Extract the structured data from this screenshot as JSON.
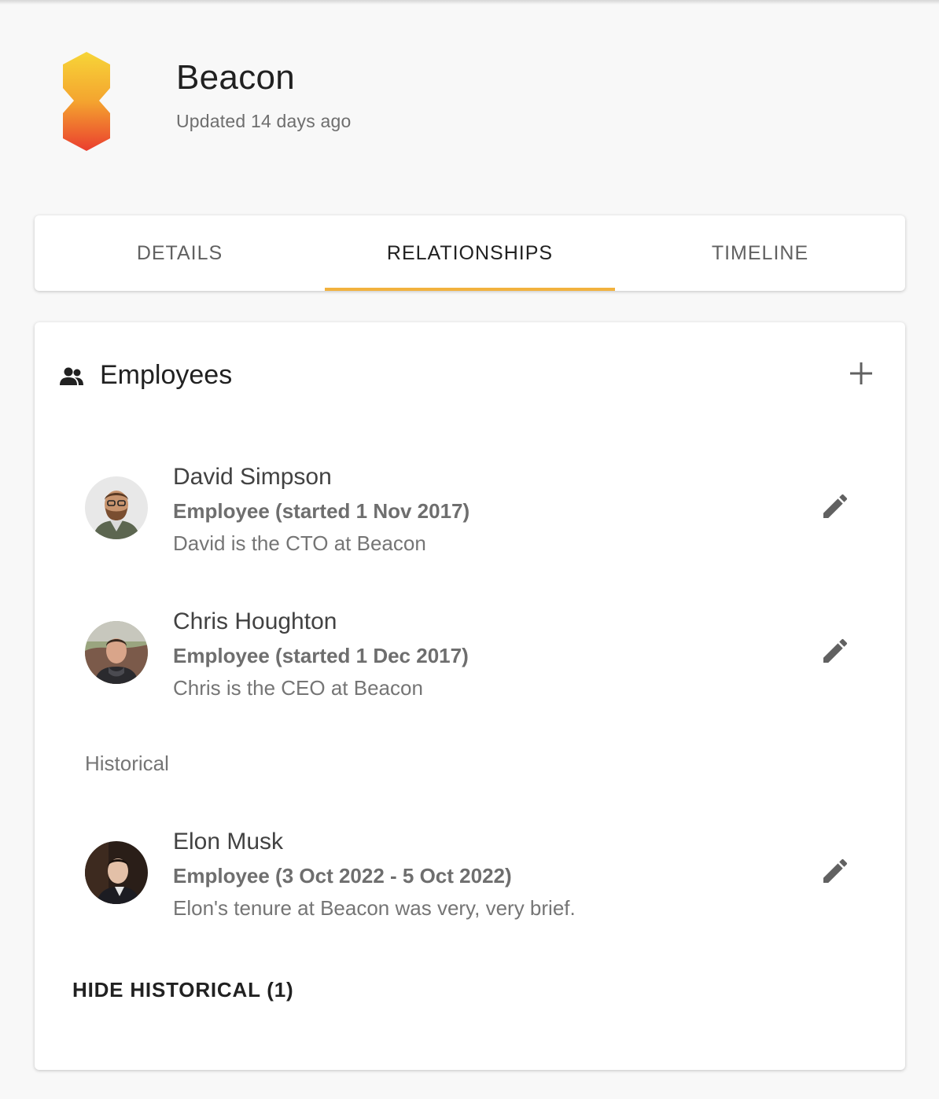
{
  "company": {
    "name": "Beacon",
    "updated": "Updated 14 days ago",
    "logo_colors": [
      "#f7d538",
      "#f28f2c",
      "#ea3e2f"
    ]
  },
  "tabs": [
    {
      "label": "DETAILS",
      "active": false
    },
    {
      "label": "RELATIONSHIPS",
      "active": true
    },
    {
      "label": "TIMELINE",
      "active": false
    }
  ],
  "accent_color": "#f2b23e",
  "employees": {
    "title": "Employees",
    "icon": "people-icon",
    "add_icon": "plus-icon",
    "current": [
      {
        "name": "David Simpson",
        "role": "Employee (started 1 Nov 2017)",
        "description": "David is the CTO at Beacon",
        "edit_icon": "pencil-icon"
      },
      {
        "name": "Chris Houghton",
        "role": "Employee (started 1 Dec 2017)",
        "description": "Chris is the CEO at Beacon",
        "edit_icon": "pencil-icon"
      }
    ],
    "historical_label": "Historical",
    "historical": [
      {
        "name": "Elon Musk",
        "role": "Employee (3 Oct 2022 - 5 Oct 2022)",
        "description": "Elon's tenure at Beacon was very, very brief.",
        "edit_icon": "pencil-icon"
      }
    ],
    "hide_historical_label": "HIDE HISTORICAL (1)"
  }
}
